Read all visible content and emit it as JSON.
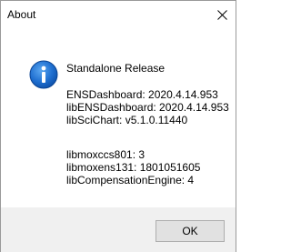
{
  "window": {
    "title": "About",
    "close_glyph": "✕"
  },
  "dialog": {
    "icon": "information-icon",
    "heading": "Standalone Release",
    "versions": [
      "ENSDashboard: 2020.4.14.953",
      "libENSDashboard: 2020.4.14.953",
      "libSciChart: v5.1.0.11440"
    ],
    "libraries": [
      "libmoxccs801: 3",
      "libmoxens131: 1801051605",
      "libCompensationEngine: 4"
    ]
  },
  "footer": {
    "ok_label": "OK"
  },
  "colors": {
    "icon_blue": "#1f6fd0",
    "footer_bg": "#f0f0f0",
    "button_bg": "#e1e1e1",
    "button_border": "#adadad"
  }
}
